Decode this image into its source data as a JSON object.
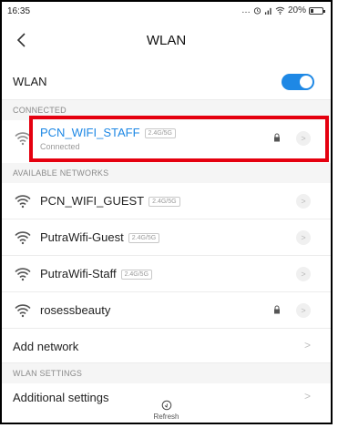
{
  "status_bar": {
    "time": "16:35",
    "icons_text": "... ⏰ .∣∣ ≈ 20%",
    "battery_percent": 20
  },
  "header": {
    "title": "WLAN"
  },
  "wlan_toggle": {
    "label": "WLAN",
    "enabled": true
  },
  "sections": {
    "connected": "CONNECTED",
    "available": "AVAILABLE NETWORKS",
    "settings": "WLAN SETTINGS"
  },
  "connected_network": {
    "name": "PCN_WIFI_STAFF",
    "band": "2.4G/5G",
    "status": "Connected",
    "locked": true
  },
  "available_networks": [
    {
      "name": "PCN_WIFI_GUEST",
      "band": "2.4G/5G",
      "locked": false
    },
    {
      "name": "PutraWifi-Guest",
      "band": "2.4G/5G",
      "locked": false
    },
    {
      "name": "PutraWifi-Staff",
      "band": "2.4G/5G",
      "locked": false
    },
    {
      "name": "rosessbeauty",
      "band": "",
      "locked": true
    }
  ],
  "add_network": {
    "label": "Add network"
  },
  "additional_settings": {
    "label": "Additional settings"
  },
  "refresh": {
    "label": "Refresh"
  },
  "colors": {
    "accent": "#1e88e5",
    "highlight": "#e5000f"
  }
}
